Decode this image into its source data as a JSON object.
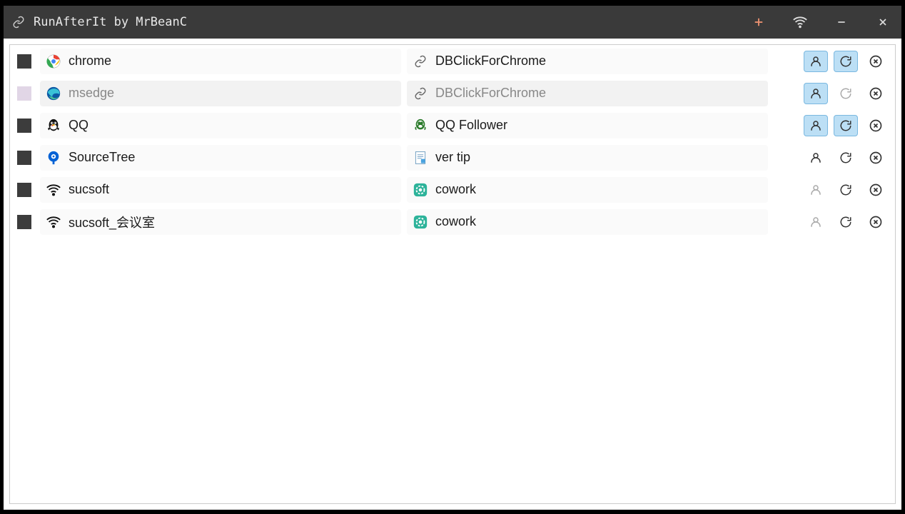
{
  "titlebar": {
    "title": "RunAfterIt by MrBeanC"
  },
  "rows": [
    {
      "checkbox": "dark",
      "left_icon": "chrome",
      "left_label": "chrome",
      "right_icon": "link",
      "right_label": "DBClickForChrome",
      "dimmed": false,
      "person_active": true,
      "refresh_active": true,
      "close_muted": false
    },
    {
      "checkbox": "light",
      "left_icon": "edge",
      "left_label": "msedge",
      "right_icon": "link",
      "right_label": "DBClickForChrome",
      "dimmed": true,
      "person_active": true,
      "refresh_active": false,
      "close_muted": false
    },
    {
      "checkbox": "dark",
      "left_icon": "qq",
      "left_label": "QQ",
      "right_icon": "qqfollower",
      "right_label": "QQ Follower",
      "dimmed": false,
      "person_active": true,
      "refresh_active": true,
      "close_muted": false
    },
    {
      "checkbox": "dark",
      "left_icon": "sourcetree",
      "left_label": "SourceTree",
      "right_icon": "doc",
      "right_label": "ver tip",
      "dimmed": false,
      "person_active": false,
      "refresh_active": false,
      "close_muted": false
    },
    {
      "checkbox": "dark",
      "left_icon": "wifi",
      "left_label": "sucsoft",
      "right_icon": "cowork",
      "right_label": "cowork",
      "dimmed": false,
      "person_active": false,
      "refresh_active": false,
      "close_muted": false,
      "person_muted": true
    },
    {
      "checkbox": "dark",
      "left_icon": "wifi",
      "left_label": "sucsoft_会议室",
      "right_icon": "cowork",
      "right_label": "cowork",
      "dimmed": false,
      "person_active": false,
      "refresh_active": false,
      "close_muted": false,
      "person_muted": true
    }
  ]
}
